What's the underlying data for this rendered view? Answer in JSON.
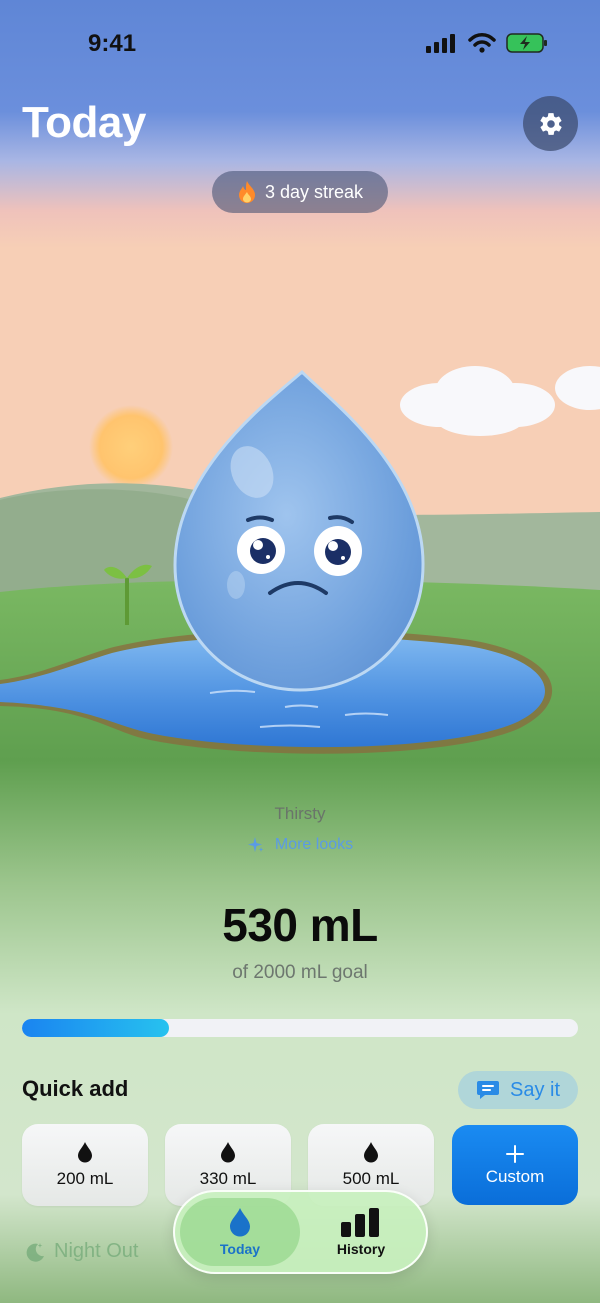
{
  "status_bar": {
    "time": "9:41"
  },
  "header": {
    "title": "Today"
  },
  "streak": {
    "label": "3 day streak"
  },
  "mascot": {
    "mood": "Thirsty",
    "more_looks": "More looks"
  },
  "progress": {
    "amount": "530 mL",
    "goal_text": "of 2000 mL goal",
    "fraction": 0.265
  },
  "quick_add": {
    "title": "Quick add",
    "say_it": "Say it",
    "options": [
      "200 mL",
      "330 mL",
      "500 mL"
    ],
    "custom": "Custom"
  },
  "night_out": "Night Out",
  "tabs": {
    "today": "Today",
    "history": "History"
  },
  "colors": {
    "accent": "#1a84f0",
    "sky_top": "#5f86d6",
    "grass": "#6aa858"
  },
  "icons": [
    "settings-gear-icon",
    "flame-icon",
    "sparkle-icon",
    "speech-bubble-icon",
    "water-drop-icon",
    "plus-icon",
    "moon-icon",
    "bar-chart-icon"
  ]
}
